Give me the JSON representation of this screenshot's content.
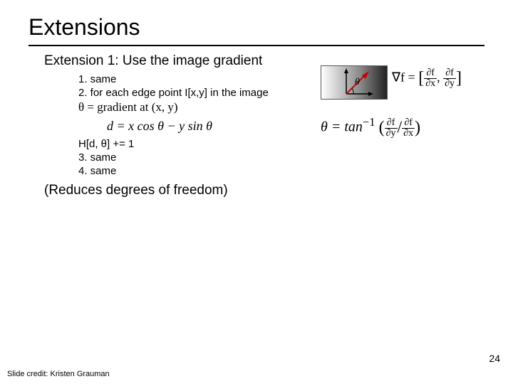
{
  "title": "Extensions",
  "ext1": "Extension 1:  Use the image gradient",
  "items": {
    "n1": "1.  same",
    "n2": "2.  for each edge point I[x,y] in the image",
    "theta_grad": "θ = gradient at (x, y)",
    "d_eq": "d = x cos θ − y sin θ",
    "h_update": "H[d, θ] += 1",
    "n3": "3.  same",
    "n4": "4.  same"
  },
  "reduces": "(Reduces degrees of freedom)",
  "grad_formula": {
    "lead": "∇f = ",
    "p1n": "∂f",
    "p1d": "∂x",
    "p2n": "∂f",
    "p2d": "∂y"
  },
  "theta_formula": {
    "lead": "θ = tan",
    "sup": "−1",
    "p1n": "∂f",
    "p1d": "∂y",
    "p2n": "∂f",
    "p2d": "∂x"
  },
  "theta_label": "θ",
  "page_number": "24",
  "credit": "Slide credit: Kristen Grauman"
}
